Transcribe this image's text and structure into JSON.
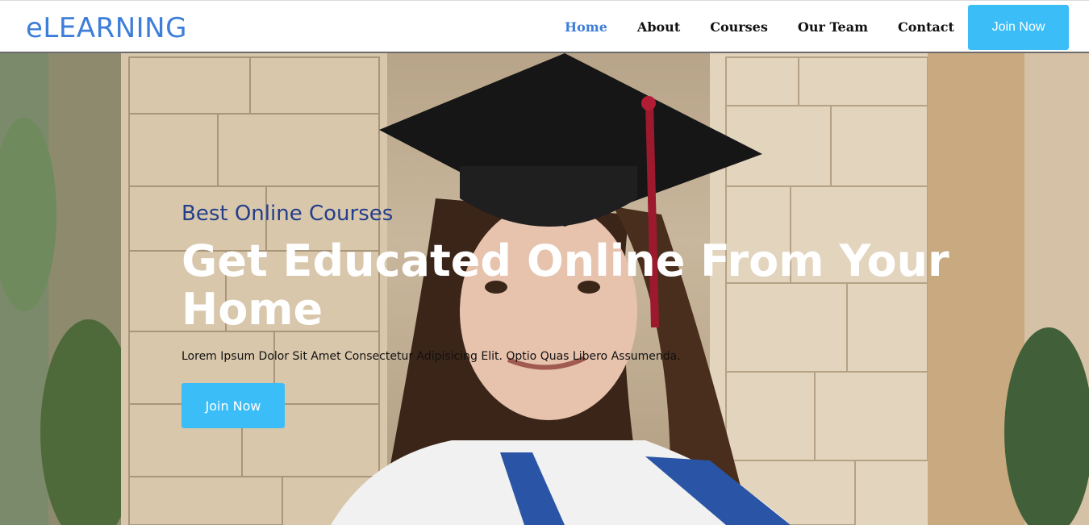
{
  "header": {
    "logo": "eLEARNING",
    "nav": [
      {
        "label": "Home",
        "active": true
      },
      {
        "label": "About",
        "active": false
      },
      {
        "label": "Courses",
        "active": false
      },
      {
        "label": "Our Team",
        "active": false
      },
      {
        "label": "Contact",
        "active": false
      }
    ],
    "join_label": "Join Now"
  },
  "hero": {
    "subtitle": "Best Online Courses",
    "headline": "Get Educated Online From Your Home",
    "description": "Lorem Ipsum Dolor Sit Amet Consectetur Adipisicing Elit. Optio Quas Libero Assumenda.",
    "join_label": "Join Now",
    "image": "graduate-photo"
  },
  "colors": {
    "accent": "#3d7ed9",
    "button": "#3bbdf7",
    "subtitle": "#243e8c"
  }
}
